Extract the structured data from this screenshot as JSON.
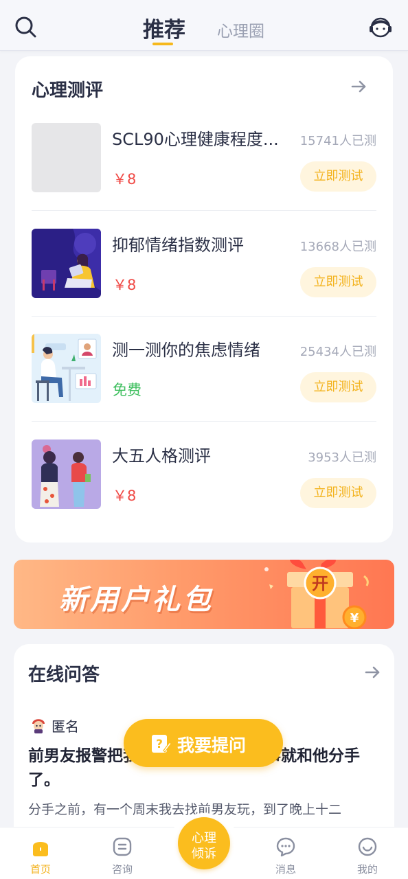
{
  "header": {
    "tab_active": "推荐",
    "tab_inactive": "心理圈"
  },
  "assessments": {
    "title": "心理测评",
    "items": [
      {
        "name": "SCL90心理健康程度...",
        "count": "15741人已测",
        "price": "￥8",
        "button": "立即测试"
      },
      {
        "name": "抑郁情绪指数测评",
        "count": "13668人已测",
        "price": "￥8",
        "button": "立即测试"
      },
      {
        "name": "测一测你的焦虑情绪",
        "count": "25434人已测",
        "price": "免费",
        "button": "立即测试"
      },
      {
        "name": "大五人格测评",
        "count": "3953人已测",
        "price": "￥8",
        "button": "立即测试"
      }
    ]
  },
  "banner": {
    "text": "新用户礼包",
    "gift_char": "开",
    "coin_char": "¥"
  },
  "qa": {
    "title": "在线问答",
    "user": "匿名",
    "question": "前男友报警把我抓了，我因为这件事就和他分手了。",
    "excerpt": "分手之前，有一个周末我去找前男友玩，到了晚上十二"
  },
  "ask_button": "我要提问",
  "nav": {
    "home": "首页",
    "consult": "咨询",
    "center_line1": "心理",
    "center_line2": "倾诉",
    "messages": "消息",
    "mine": "我的"
  },
  "colors": {
    "accent": "#fbbd1e",
    "price_red": "#f04a46",
    "free_green": "#3fbf5f"
  }
}
